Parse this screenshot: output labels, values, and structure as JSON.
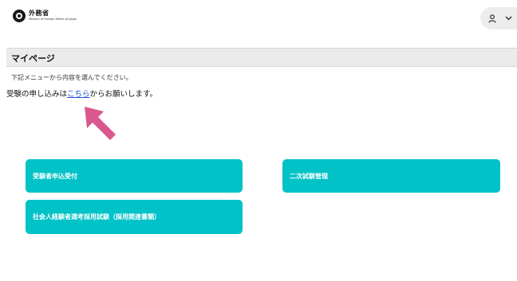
{
  "header": {
    "logo_ja": "外務省",
    "logo_en": "Ministry of Foreign Affairs of Japan",
    "user_icon": "user-icon",
    "menu_icon": "chevron-down-icon"
  },
  "page": {
    "title": "マイページ",
    "instruction": "下記メニューから内容を選んでください。",
    "apply_prefix": "受験の申し込みは",
    "apply_link": "こちら",
    "apply_suffix": "からお願いします。"
  },
  "annotation": {
    "arrow_color": "#d9588f"
  },
  "menu": {
    "tile_color": "#00c2c7",
    "items": [
      {
        "label": "受験者申込受付"
      },
      {
        "label": "二次試験管理"
      },
      {
        "label": "社会人経験者選考採用試験（採用関連書類）"
      }
    ]
  }
}
